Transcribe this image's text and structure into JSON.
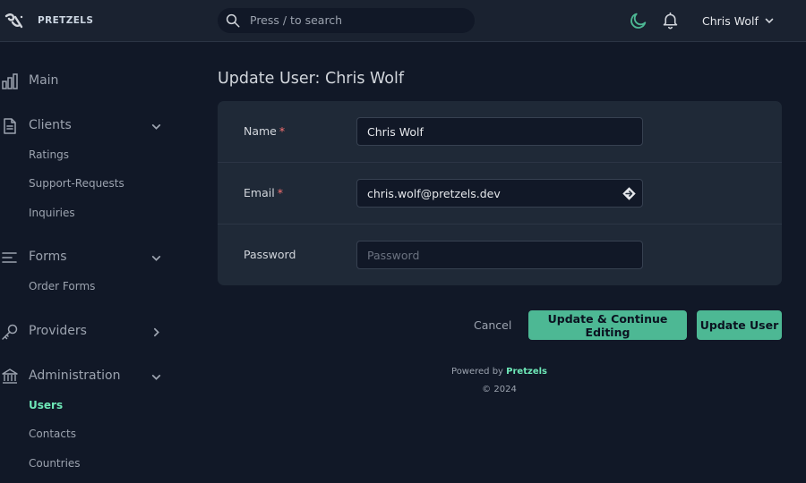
{
  "header": {
    "brand": "PRETZELS",
    "search_placeholder": "Press / to search",
    "user_name": "Chris Wolf"
  },
  "sidebar": {
    "groups": [
      {
        "label": "Main",
        "icon": "bar-chart-icon"
      },
      {
        "label": "Clients",
        "icon": "document-icon",
        "expanded": true,
        "items": [
          "Ratings",
          "Support-Requests",
          "Inquiries"
        ]
      },
      {
        "label": "Forms",
        "icon": "align-left-icon",
        "expanded": true,
        "items": [
          "Order Forms"
        ]
      },
      {
        "label": "Providers",
        "icon": "key-icon",
        "expanded": false
      },
      {
        "label": "Administration",
        "icon": "bank-icon",
        "expanded": true,
        "items": [
          "Users",
          "Contacts",
          "Countries"
        ],
        "active_item": "Users"
      }
    ]
  },
  "main": {
    "title": "Update User: Chris Wolf",
    "fields": {
      "name": {
        "label": "Name",
        "required_mark": "*",
        "value": "Chris Wolf"
      },
      "email": {
        "label": "Email",
        "required_mark": "*",
        "value": "chris.wolf@pretzels.dev"
      },
      "password": {
        "label": "Password",
        "placeholder": "Password",
        "value": ""
      }
    },
    "actions": {
      "cancel": "Cancel",
      "update_continue": "Update & Continue Editing",
      "update": "Update User"
    }
  },
  "footer": {
    "powered_by": "Powered by",
    "brand": "Pretzels",
    "copyright": "© 2024"
  },
  "colors": {
    "accent": "#4db894",
    "accent_text": "#6ee7b7",
    "background": "#111827",
    "card": "#1f2937",
    "required": "#f87171"
  }
}
